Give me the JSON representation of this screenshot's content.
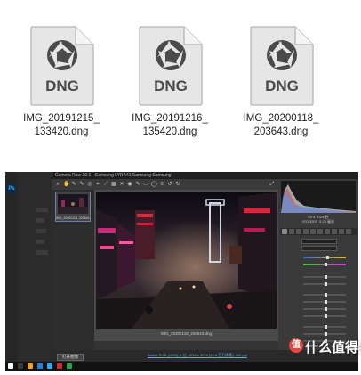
{
  "files": [
    {
      "badge": "DNG",
      "name_line1": "IMG_20191215_",
      "name_line2": "133420.dng"
    },
    {
      "badge": "DNG",
      "name_line1": "IMG_20191216_",
      "name_line2": "135420.dng"
    },
    {
      "badge": "DNG",
      "name_line1": "IMG_20200118_",
      "name_line2": "203643.dng"
    }
  ],
  "camera_raw": {
    "title": "Camera Raw 10.1  -  Samsung LYRA41 Samsung Samsung",
    "thumbnail_label": "IMG_20200118_203643.dng",
    "preview_filename": "IMG_20200118_203643.dng",
    "readout": "f/2.4  1/24 秒\nISO 3200  5.23 毫米",
    "open_button": "打开图像",
    "workflow_link": "Adobe RGB (1998); 8 位; 4096 x 3072 (12.6 百万像素); 300 ppi"
  },
  "colors": {
    "accent": "#31a8ff",
    "watermark_badge": "#e8463f"
  },
  "watermark": {
    "badge": "值",
    "text": "什么值得买"
  }
}
